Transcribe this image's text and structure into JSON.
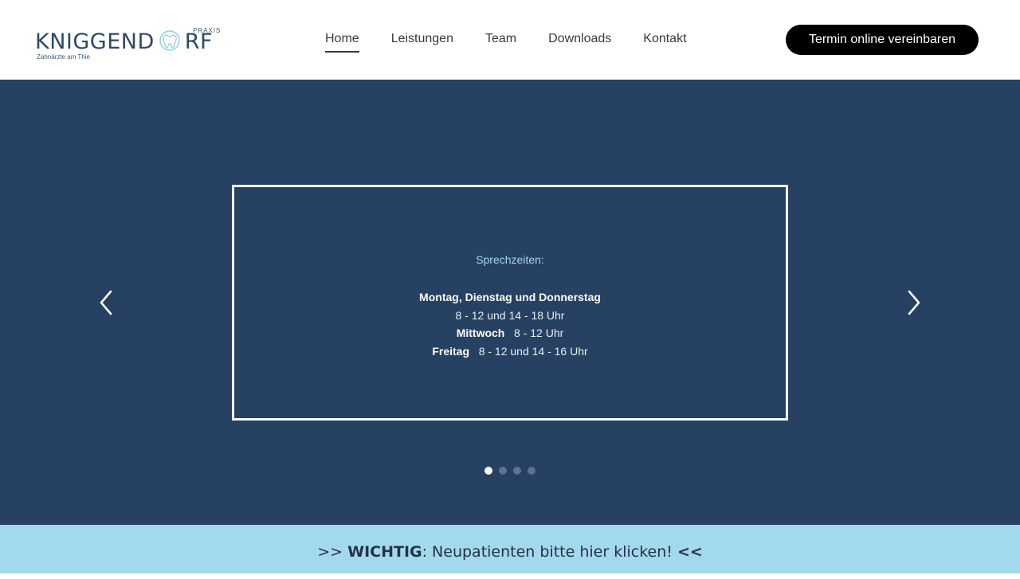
{
  "logo": {
    "name": "KNIGGEND",
    "name_end": "RF",
    "praxis": "PRAXIS",
    "tagline": "Zahnärzte am Thie"
  },
  "nav": {
    "items": [
      {
        "label": "Home"
      },
      {
        "label": "Leistungen"
      },
      {
        "label": "Team"
      },
      {
        "label": "Downloads"
      },
      {
        "label": "Kontakt"
      }
    ],
    "active": "Home"
  },
  "cta": {
    "label": "Termin online vereinbaren"
  },
  "slider": {
    "heading": "Sprechzeiten:",
    "lines": [
      {
        "bold": "Montag, Dienstag und Donnerstag",
        "text": ""
      },
      {
        "bold": "",
        "text": "8 - 12  und  14 - 18 Uhr"
      },
      {
        "bold": "Mittwoch",
        "text": "8 - 12 Uhr"
      },
      {
        "bold": "Freitag",
        "text": "8 - 12  und  14 - 16 Uhr"
      }
    ],
    "dot_count": 4,
    "active_dot": 1
  },
  "banner": {
    "prefix": ">> ",
    "strong": "WICHTIG",
    "text": ": Neupatienten bitte hier klicken! ",
    "suffix": "<<"
  },
  "colors": {
    "hero_bg": "#264162",
    "banner_bg": "#a2d9ed",
    "accent_heading": "#a4d9ee",
    "cta_bg": "#000000"
  }
}
